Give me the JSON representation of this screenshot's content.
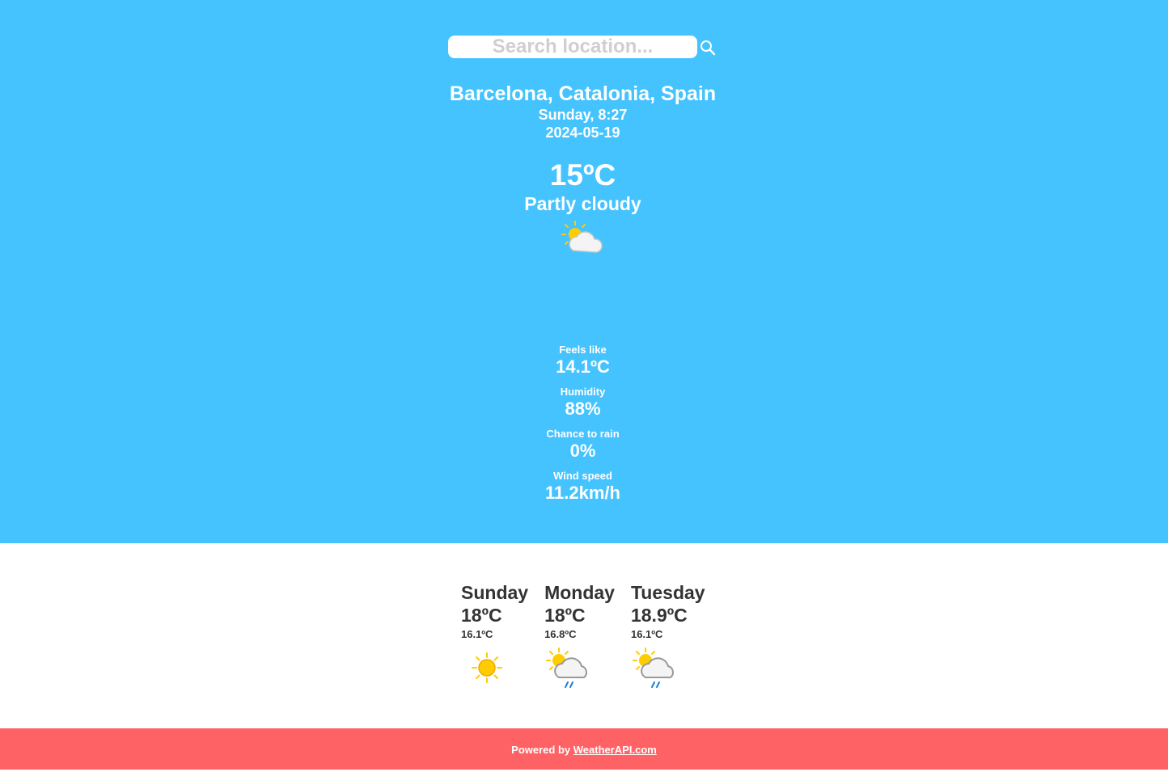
{
  "search": {
    "placeholder": "Search location..."
  },
  "current": {
    "location": "Barcelona, Catalonia, Spain",
    "day_time": "Sunday, 8:27",
    "date": "2024-05-19",
    "temperature": "15ºC",
    "condition": "Partly cloudy",
    "condition_icon": "partly-cloudy-icon"
  },
  "stats": [
    {
      "label": "Feels like",
      "value": "14.1ºC"
    },
    {
      "label": "Humidity",
      "value": "88%"
    },
    {
      "label": "Chance to rain",
      "value": "0%"
    },
    {
      "label": "Wind speed",
      "value": "11.2km/h"
    }
  ],
  "forecast": [
    {
      "day": "Sunday",
      "max": "18ºC",
      "min": "16.1ºC",
      "icon": "sunny-icon"
    },
    {
      "day": "Monday",
      "max": "18ºC",
      "min": "16.8ºC",
      "icon": "patchy-rain-icon"
    },
    {
      "day": "Tuesday",
      "max": "18.9ºC",
      "min": "16.1ºC",
      "icon": "patchy-rain-icon"
    }
  ],
  "footer": {
    "prefix": "Powered by ",
    "link_text": "WeatherAPI.com"
  },
  "colors": {
    "hero_bg": "#45c3ff",
    "footer_bg": "#ff6264",
    "sun": "#ffcc00",
    "cloud": "#f4f4f4",
    "rain": "#1e7fd8"
  }
}
